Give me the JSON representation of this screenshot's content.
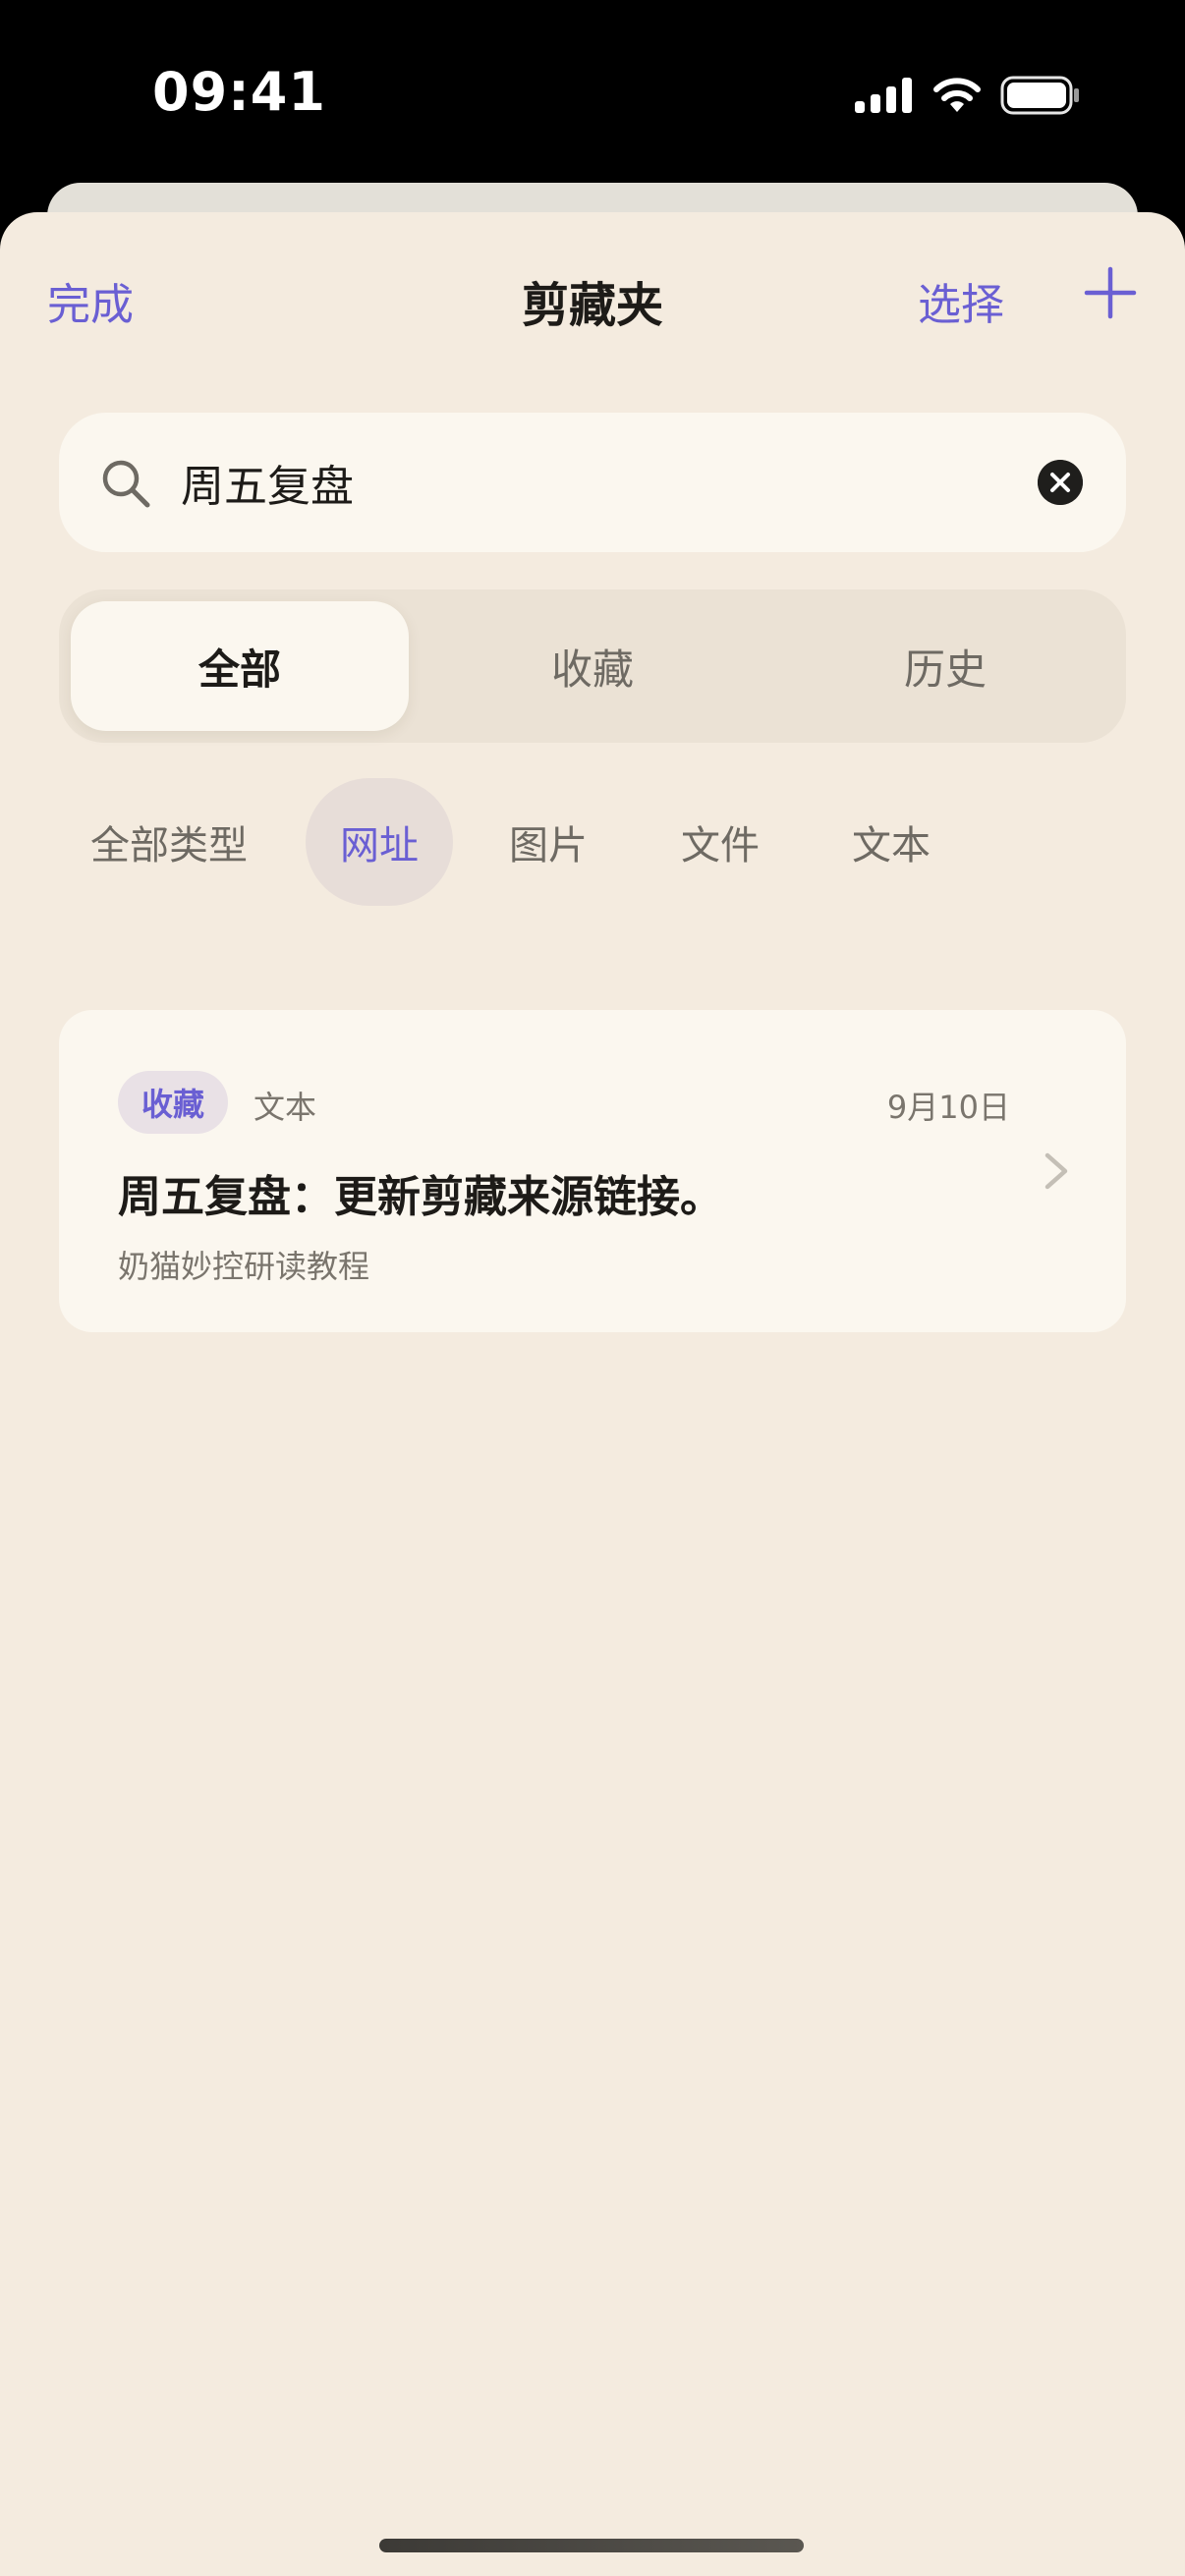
{
  "status_bar": {
    "time": "09:41"
  },
  "nav": {
    "done_label": "完成",
    "title": "剪藏夹",
    "select_label": "选择"
  },
  "search": {
    "value": "周五复盘"
  },
  "segments": [
    {
      "label": "全部",
      "active": true
    },
    {
      "label": "收藏",
      "active": false
    },
    {
      "label": "历史",
      "active": false
    }
  ],
  "type_chips": [
    {
      "label": "全部类型",
      "active": false
    },
    {
      "label": "网址",
      "active": true
    },
    {
      "label": "图片",
      "active": false
    },
    {
      "label": "文件",
      "active": false
    },
    {
      "label": "文本",
      "active": false
    }
  ],
  "results": [
    {
      "tag": "收藏",
      "kind": "文本",
      "date": "9月10日",
      "title": "周五复盘：更新剪藏来源链接。",
      "subtitle": "奶猫妙控研读教程"
    }
  ],
  "colors": {
    "accent": "#6a5fd3",
    "sheet_background": "#f4ebdf",
    "card_background": "#fbf7ef",
    "text_primary": "#1d1b18",
    "text_secondary": "#7a756d"
  },
  "icons": [
    "cellular-signal-icon",
    "wifi-icon",
    "battery-icon",
    "plus-icon",
    "search-icon",
    "clear-icon",
    "chevron-right-icon"
  ]
}
